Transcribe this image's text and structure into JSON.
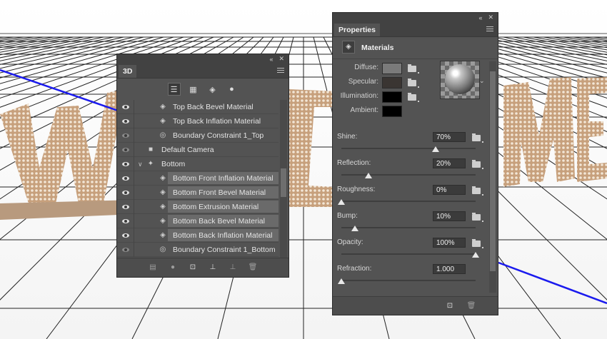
{
  "colors": {
    "panel_bg": "#535353",
    "panel_header": "#424242",
    "row_selected": "#6a6a6a",
    "grid_line": "#2a2a2a",
    "axis_blue": "#1010ee",
    "letter_fill": "#c9a88a",
    "diffuse_swatch": "#7a7a7a",
    "specular_swatch": "#3a3532",
    "illumination_swatch": "#000000",
    "ambient_swatch": "#000000"
  },
  "panel3d": {
    "tab_label": "3D",
    "filter_icons": [
      "scene-filter-icon",
      "mesh-filter-icon",
      "material-filter-icon",
      "light-filter-icon"
    ],
    "layers": [
      {
        "label": "Top Back Bevel Material",
        "type": "material",
        "indent": 2,
        "visible": true,
        "selected": false
      },
      {
        "label": "Top Back Inflation Material",
        "type": "material",
        "indent": 2,
        "visible": true,
        "selected": false
      },
      {
        "label": "Boundary Constraint 1_Top",
        "type": "constraint",
        "indent": 2,
        "visible": false,
        "selected": false
      },
      {
        "label": "Default Camera",
        "type": "camera",
        "indent": 1,
        "visible": false,
        "selected": false
      },
      {
        "label": "Bottom",
        "type": "mesh",
        "indent": 1,
        "visible": true,
        "selected": false,
        "expanded": true
      },
      {
        "label": "Bottom Front Inflation Material",
        "type": "material",
        "indent": 2,
        "visible": true,
        "selected": true
      },
      {
        "label": "Bottom Front Bevel Material",
        "type": "material",
        "indent": 2,
        "visible": true,
        "selected": true
      },
      {
        "label": "Bottom Extrusion Material",
        "type": "material",
        "indent": 2,
        "visible": true,
        "selected": true
      },
      {
        "label": "Bottom Back Bevel Material",
        "type": "material",
        "indent": 2,
        "visible": true,
        "selected": true
      },
      {
        "label": "Bottom Back Inflation Material",
        "type": "material",
        "indent": 2,
        "visible": true,
        "selected": true
      },
      {
        "label": "Boundary Constraint 1_Bottom",
        "type": "constraint",
        "indent": 2,
        "visible": false,
        "selected": false
      }
    ],
    "bottom_icons": [
      "render-icon",
      "light-add-icon",
      "drop-to-plane-icon",
      "new-constraint-icon",
      "toggle-objects-icon",
      "trash-icon"
    ]
  },
  "properties": {
    "tab_label": "Properties",
    "section_label": "Materials",
    "texture_maps": [
      {
        "label": "Diffuse:",
        "color": "#7a7a7a"
      },
      {
        "label": "Specular:",
        "color": "#3a3532"
      },
      {
        "label": "Illumination:",
        "color": "#000000"
      },
      {
        "label": "Ambient:",
        "color": "#000000"
      }
    ],
    "sliders": [
      {
        "label": "Shine:",
        "value": "70%",
        "fraction": 0.7
      },
      {
        "label": "Reflection:",
        "value": "20%",
        "fraction": 0.2
      },
      {
        "label": "Roughness:",
        "value": "0%",
        "fraction": 0.0
      },
      {
        "label": "Bump:",
        "value": "10%",
        "fraction": 0.1
      },
      {
        "label": "Opacity:",
        "value": "100%",
        "fraction": 1.0
      },
      {
        "label": "Refraction:",
        "value": "1.000",
        "fraction": 0.0
      }
    ],
    "bottom_icons": [
      "material-apply-icon",
      "trash-icon"
    ]
  }
}
